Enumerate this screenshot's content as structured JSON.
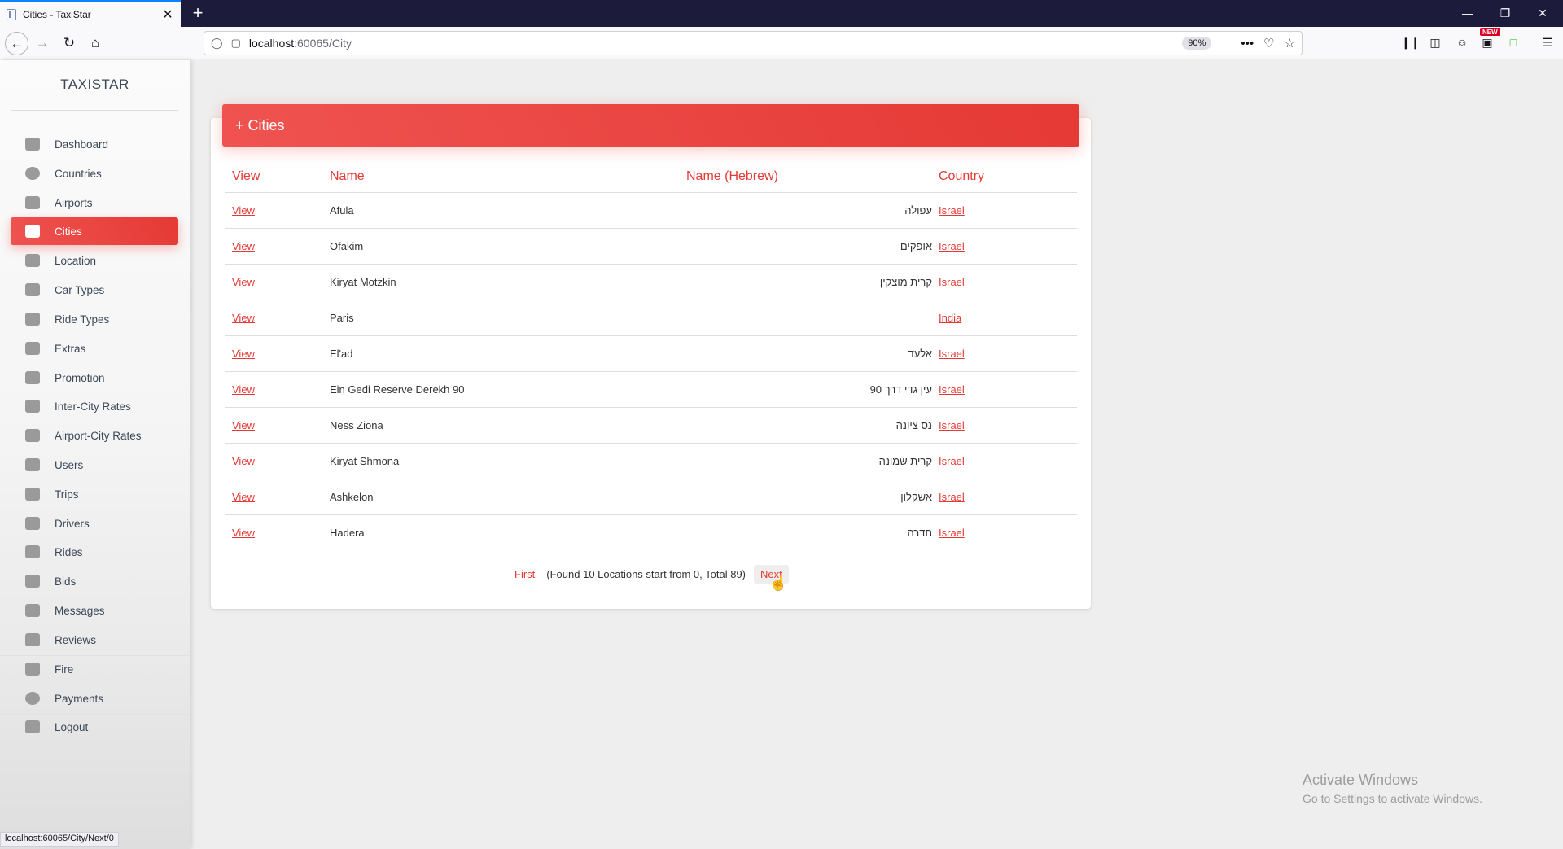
{
  "browser": {
    "tab_title": "Cities - TaxiStar",
    "tab_close": "✕",
    "new_tab": "+",
    "url_host": "localhost",
    "url_rest": ":60065/City",
    "zoom": "90%",
    "more_actions": "•••",
    "status_url": "localhost:60065/City/Next/0",
    "new_badge": "NEW"
  },
  "sidebar": {
    "brand": "TAXISTAR",
    "items": [
      {
        "label": "Dashboard",
        "icon": "dashboard-icon"
      },
      {
        "label": "Countries",
        "icon": "globe-icon"
      },
      {
        "label": "Airports",
        "icon": "plane-icon"
      },
      {
        "label": "Cities",
        "icon": "city-icon",
        "active": true
      },
      {
        "label": "Location",
        "icon": "map-pin-icon"
      },
      {
        "label": "Car Types",
        "icon": "car-icon"
      },
      {
        "label": "Ride Types",
        "icon": "seat-icon"
      },
      {
        "label": "Extras",
        "icon": "tag-icon"
      },
      {
        "label": "Promotion",
        "icon": "megaphone-icon"
      },
      {
        "label": "Inter-City Rates",
        "icon": "rates-icon"
      },
      {
        "label": "Airport-City Rates",
        "icon": "departure-icon"
      },
      {
        "label": "Users",
        "icon": "user-icon"
      },
      {
        "label": "Trips",
        "icon": "route-icon"
      },
      {
        "label": "Drivers",
        "icon": "car-front-icon"
      },
      {
        "label": "Rides",
        "icon": "bus-icon"
      },
      {
        "label": "Bids",
        "icon": "check-square-icon"
      },
      {
        "label": "Messages",
        "icon": "message-icon"
      },
      {
        "label": "Reviews",
        "icon": "review-icon"
      },
      {
        "label": "Fire",
        "icon": "clipboard-icon"
      },
      {
        "label": "Payments",
        "icon": "dollar-icon"
      },
      {
        "label": "Logout",
        "icon": "plug-icon"
      }
    ]
  },
  "page": {
    "title": "+ Cities",
    "columns": [
      "View",
      "Name",
      "Name (Hebrew)",
      "Country"
    ],
    "rows": [
      {
        "view": "View",
        "name": "Afula",
        "hebrew": "עפולה",
        "country": "Israel"
      },
      {
        "view": "View",
        "name": "Ofakim",
        "hebrew": "אופקים",
        "country": "Israel"
      },
      {
        "view": "View",
        "name": "Kiryat Motzkin",
        "hebrew": "קרית מוצקין",
        "country": "Israel"
      },
      {
        "view": "View",
        "name": "Paris",
        "hebrew": "",
        "country": "India"
      },
      {
        "view": "View",
        "name": "El'ad",
        "hebrew": "אלעד",
        "country": "Israel"
      },
      {
        "view": "View",
        "name": "Ein Gedi Reserve Derekh 90",
        "hebrew": "עין גדי דרך 90",
        "country": "Israel"
      },
      {
        "view": "View",
        "name": "Ness Ziona",
        "hebrew": "נס ציונה",
        "country": "Israel"
      },
      {
        "view": "View",
        "name": "Kiryat Shmona",
        "hebrew": "קרית שמונה",
        "country": "Israel"
      },
      {
        "view": "View",
        "name": "Ashkelon",
        "hebrew": "אשקלון",
        "country": "Israel"
      },
      {
        "view": "View",
        "name": "Hadera",
        "hebrew": "חדרה",
        "country": "Israel"
      }
    ],
    "pager": {
      "first": "First",
      "info": "(Found 10 Locations start from 0, Total 89)",
      "next": "Next"
    }
  },
  "watermark": {
    "title": "Activate Windows",
    "subtitle": "Go to Settings to activate Windows."
  },
  "colors": {
    "accent": "#e53935",
    "titlebar": "#1c1b3b"
  }
}
